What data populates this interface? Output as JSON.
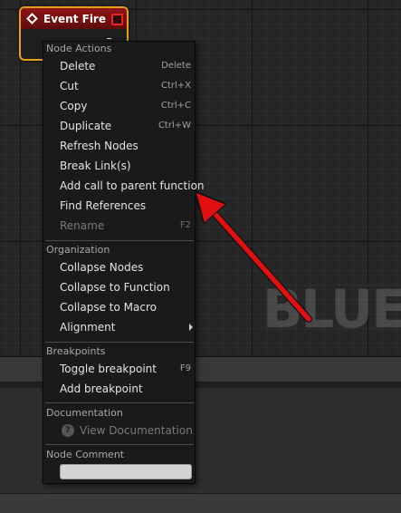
{
  "graph": {
    "watermark": "BLUEP"
  },
  "node": {
    "title": "Event Fire",
    "icons": {
      "event": "event-diamond-icon",
      "delegate": "delegate-pin-icon",
      "exec": "exec-pin-icon"
    }
  },
  "menu": {
    "node_actions": {
      "title": "Node Actions",
      "items": [
        {
          "label": "Delete",
          "shortcut": "Delete"
        },
        {
          "label": "Cut",
          "shortcut": "Ctrl+X"
        },
        {
          "label": "Copy",
          "shortcut": "Ctrl+C"
        },
        {
          "label": "Duplicate",
          "shortcut": "Ctrl+W"
        },
        {
          "label": "Refresh Nodes",
          "shortcut": ""
        },
        {
          "label": "Break Link(s)",
          "shortcut": ""
        },
        {
          "label": "Add call to parent function",
          "shortcut": ""
        },
        {
          "label": "Find References",
          "shortcut": ""
        },
        {
          "label": "Rename",
          "shortcut": "F2",
          "disabled": true
        }
      ]
    },
    "organization": {
      "title": "Organization",
      "items": [
        {
          "label": "Collapse Nodes"
        },
        {
          "label": "Collapse to Function"
        },
        {
          "label": "Collapse to Macro"
        },
        {
          "label": "Alignment",
          "submenu": true
        }
      ]
    },
    "breakpoints": {
      "title": "Breakpoints",
      "items": [
        {
          "label": "Toggle breakpoint",
          "shortcut": "F9"
        },
        {
          "label": "Add breakpoint",
          "shortcut": ""
        }
      ]
    },
    "documentation": {
      "title": "Documentation",
      "items": [
        {
          "label": "View Documentation",
          "disabled": true,
          "icon": "help-icon"
        }
      ]
    },
    "node_comment": {
      "title": "Node Comment",
      "value": ""
    }
  },
  "colors": {
    "node_border": "#e8a01a",
    "node_header": "#8e1414",
    "annotation_arrow": "#e01010"
  }
}
